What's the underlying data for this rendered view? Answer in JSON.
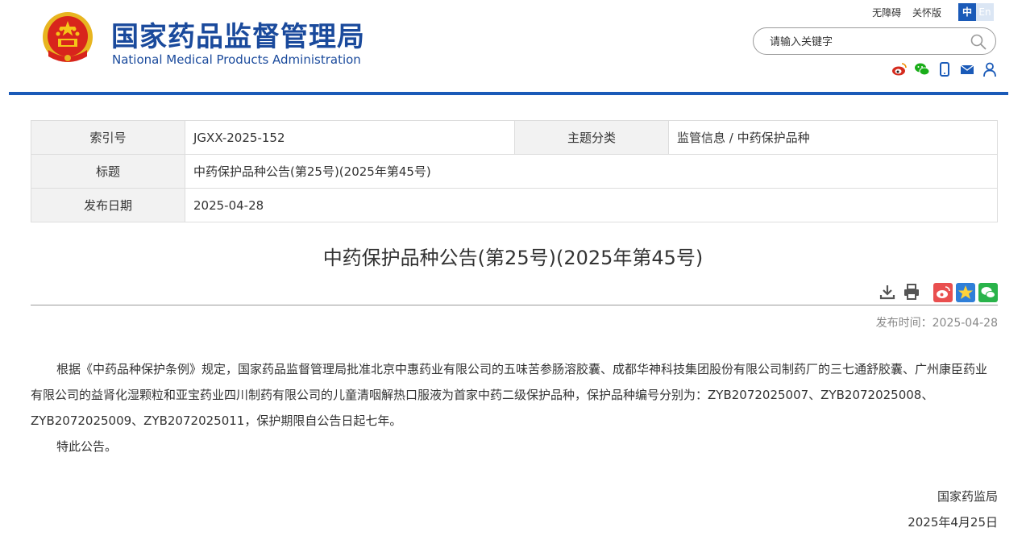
{
  "header": {
    "site_title_cn": "国家药品监督管理局",
    "site_title_en": "National Medical Products Administration",
    "links": [
      "无障碍",
      "关怀版"
    ],
    "lang_zh": "中",
    "lang_en": "En",
    "search_placeholder": "请输入关键字",
    "social_icons": [
      "weibo-icon",
      "wechat-icon",
      "mobile-icon",
      "mail-icon",
      "user-icon"
    ],
    "accent_color": "#1a5ab8"
  },
  "info": {
    "index_label": "索引号",
    "index_value": "JGXX-2025-152",
    "category_label": "主题分类",
    "category_value": "监管信息 / 中药保护品种",
    "title_label": "标题",
    "title_value": "中药保护品种公告(第25号)(2025年第45号)",
    "date_label": "发布日期",
    "date_value": "2025-04-28"
  },
  "article": {
    "title": "中药保护品种公告(第25号)(2025年第45号)",
    "tool_icons": [
      "download-icon",
      "print-icon",
      "weibo-share-icon",
      "qzone-share-icon",
      "wechat-share-icon"
    ],
    "publish_time": "发布时间：2025-04-28",
    "paragraph1": "根据《中药品种保护条例》规定，国家药品监督管理局批准北京中惠药业有限公司的五味苦参肠溶胶囊、成都华神科技集团股份有限公司制药厂的三七通舒胶囊、广州康臣药业有限公司的益肾化湿颗粒和亚宝药业四川制药有限公司的儿童清咽解热口服液为首家中药二级保护品种，保护品种编号分别为：ZYB2072025007、ZYB2072025008、ZYB2072025009、ZYB2072025011，保护期限自公告日起七年。",
    "paragraph2": "特此公告。",
    "sign_org": "国家药监局",
    "sign_date": "2025年4月25日"
  }
}
